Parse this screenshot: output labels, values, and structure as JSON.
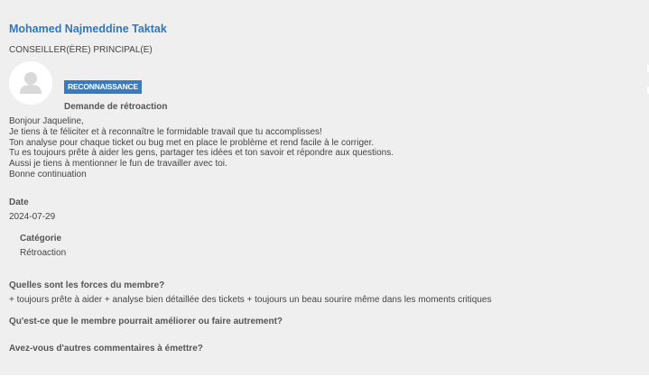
{
  "author": {
    "name": "Mohamed Najmeddine Taktak",
    "role": "CONSEILLER(ÈRE) PRINCIPAL(E)",
    "avatar_icon": "user-avatar-placeholder-icon"
  },
  "badge": {
    "label": "RECONNAISSANCE",
    "color": "#3a7bbf"
  },
  "request_title": "Demande de rétroaction",
  "message_lines": [
    "Bonjour Jaqueline,",
    "Je tiens à te féliciter et à reconnaître le formidable travail que tu accomplisses!",
    "Ton analyse pour chaque ticket ou bug met en place le problème et rend facile à le corriger.",
    "Tu es toujours prête à aider les gens, partager tes idées et ton savoir et répondre aux questions.",
    "Aussi je tiens à mentionner le fun de travailler avec toi.",
    "Bonne continuation"
  ],
  "date": {
    "label": "Date",
    "value": "2024-07-29"
  },
  "category": {
    "label": "Catégorie",
    "value": "Rétroaction"
  },
  "questions": {
    "strengths_label": "Quelles sont les forces du membre?",
    "strengths_value": "+ toujours prête à aider + analyse bien détaillée des tickets + toujours un beau sourire même dans les moments critiques",
    "improve_label": "Qu'est-ce que le membre pourrait améliorer ou faire autrement?",
    "comments_label": "Avez-vous d'autres commentaires à émettre?"
  },
  "colors": {
    "name_link": "#2f78be",
    "background": "#efefef"
  }
}
